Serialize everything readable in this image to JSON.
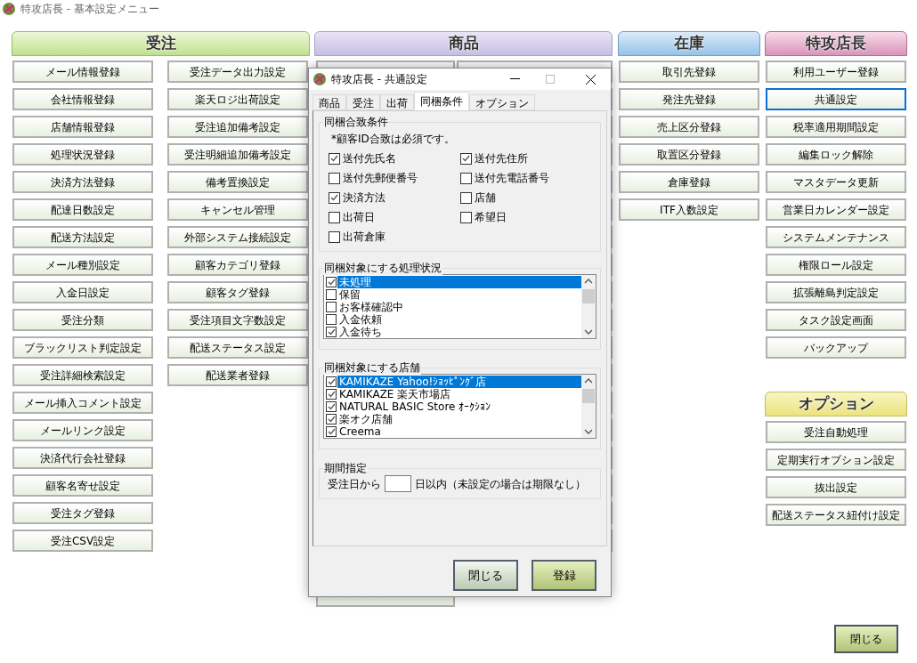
{
  "window": {
    "title": "特攻店長 - 基本設定メニュー"
  },
  "order_menu": {
    "header": "受注",
    "column_1": [
      "メール情報登録",
      "会社情報登録",
      "店舗情報登録",
      "処理状況登録",
      "決済方法登録",
      "配達日数設定",
      "配送方法設定",
      "メール種別設定",
      "入金日設定",
      "受注分類",
      "ブラックリスト判定設定",
      "受注詳細検索設定",
      "メール挿入コメント設定",
      "メールリンク設定",
      "決済代行会社登録",
      "顧客名寄せ設定",
      "受注タグ登録",
      "受注CSV設定"
    ],
    "column_2": [
      "受注データ出力設定",
      "楽天ロジ出荷設定",
      "受注追加備考設定",
      "受注明細追加備考設定",
      "備考置換設定",
      "キャンセル管理",
      "外部システム接続設定",
      "顧客カテゴリ登録",
      "顧客タグ登録",
      "受注項目文字数設定",
      "配送ステータス設定",
      "配送業者登録"
    ]
  },
  "product_menu": {
    "header": "商品"
  },
  "stock_menu": {
    "header": "在庫",
    "items": [
      "取引先登録",
      "発注先登録",
      "売上区分登録",
      "取置区分登録",
      "倉庫登録",
      "ITF入数設定"
    ]
  },
  "admin_menu": {
    "header": "特攻店長",
    "items": [
      {
        "label": "利用ユーザー登録",
        "selected": false
      },
      {
        "label": "共通設定",
        "selected": true
      },
      {
        "label": "税率適用期間設定",
        "selected": false
      },
      {
        "label": "編集ロック解除",
        "selected": false
      },
      {
        "label": "マスタデータ更新",
        "selected": false
      },
      {
        "label": "営業日カレンダー設定",
        "selected": false
      },
      {
        "label": "システムメンテナンス",
        "selected": false
      },
      {
        "label": "権限ロール設定",
        "selected": false
      },
      {
        "label": "拡張離島判定設定",
        "selected": false
      },
      {
        "label": "タスク設定画面",
        "selected": false
      },
      {
        "label": "バックアップ",
        "selected": false
      }
    ]
  },
  "option_menu": {
    "header": "オプション",
    "items": [
      "受注自動処理",
      "定期実行オプション設定",
      "抜出設定",
      "配送ステータス紐付け設定"
    ]
  },
  "close_button": "閉じる",
  "dialog": {
    "title": "特攻店長 - 共通設定",
    "tabs": [
      {
        "label": "商品",
        "selected": false
      },
      {
        "label": "受注",
        "selected": false
      },
      {
        "label": "出荷",
        "selected": false
      },
      {
        "label": "同梱条件",
        "selected": true
      },
      {
        "label": "オプション",
        "selected": false
      }
    ],
    "match_group": {
      "legend": "同梱合致条件",
      "note": "*顧客ID合致は必須です。",
      "options": [
        {
          "label": "送付先氏名",
          "checked": true
        },
        {
          "label": "送付先住所",
          "checked": true
        },
        {
          "label": "送付先郵便番号",
          "checked": false
        },
        {
          "label": "送付先電話番号",
          "checked": false
        },
        {
          "label": "決済方法",
          "checked": true
        },
        {
          "label": "店舗",
          "checked": false
        },
        {
          "label": "出荷日",
          "checked": false
        },
        {
          "label": "希望日",
          "checked": false
        },
        {
          "label": "出荷倉庫",
          "checked": false
        }
      ]
    },
    "status_group": {
      "legend": "同梱対象にする処理状況",
      "items": [
        {
          "label": "未処理",
          "checked": true,
          "selected": true
        },
        {
          "label": "保留",
          "checked": false,
          "selected": false
        },
        {
          "label": "お客様確認中",
          "checked": false,
          "selected": false
        },
        {
          "label": "入金依頼",
          "checked": false,
          "selected": false
        },
        {
          "label": "入金待ち",
          "checked": true,
          "selected": false
        }
      ]
    },
    "shop_group": {
      "legend": "同梱対象にする店舗",
      "items": [
        {
          "label": "KAMIKAZE Yahoo!ｼｮｯﾋﾟﾝｸﾞ店",
          "checked": true,
          "selected": true
        },
        {
          "label": "KAMIKAZE 楽天市場店",
          "checked": true,
          "selected": false
        },
        {
          "label": "NATURAL BASIC Store ｵｰｸｼｮﾝ",
          "checked": true,
          "selected": false
        },
        {
          "label": "楽オク店舗",
          "checked": true,
          "selected": false
        },
        {
          "label": "Creema",
          "checked": true,
          "selected": false
        }
      ]
    },
    "period_group": {
      "legend": "期間指定",
      "prefix": "受注日から",
      "suffix": "日以内（未設定の場合は期限なし）"
    },
    "buttons": [
      {
        "label": "閉じる",
        "kind": "close"
      },
      {
        "label": "登録",
        "kind": "register"
      }
    ]
  }
}
